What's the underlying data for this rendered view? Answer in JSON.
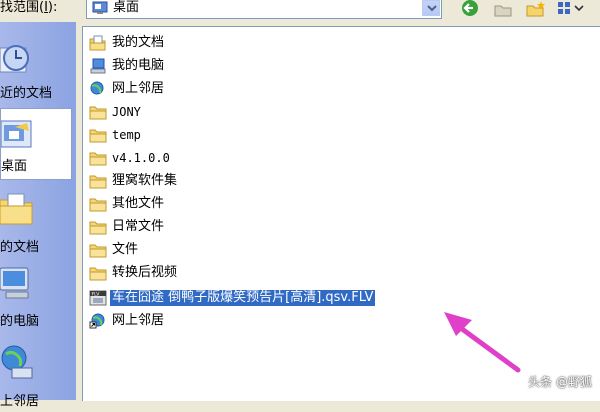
{
  "toolbar": {
    "lookin_label": "找范围(",
    "lookin_underline": "I",
    "lookin_suffix": "):",
    "current_folder": "桌面"
  },
  "places": [
    {
      "label": "近的文档",
      "icon": "recent-documents-icon",
      "selected": false
    },
    {
      "label": "桌面",
      "icon": "desktop-icon",
      "selected": true
    },
    {
      "label": "的文档",
      "icon": "my-documents-icon",
      "selected": false
    },
    {
      "label": "的电脑",
      "icon": "my-computer-icon",
      "selected": false
    },
    {
      "label": "上邻居",
      "icon": "network-places-icon",
      "selected": false
    }
  ],
  "files": [
    {
      "name": "我的文档",
      "icon": "my-documents-icon",
      "mono": false
    },
    {
      "name": "我的电脑",
      "icon": "my-computer-icon",
      "mono": false
    },
    {
      "name": "网上邻居",
      "icon": "network-places-icon",
      "mono": false
    },
    {
      "name": "JONY",
      "icon": "folder-icon",
      "mono": true
    },
    {
      "name": "temp",
      "icon": "folder-icon",
      "mono": true
    },
    {
      "name": "v4.1.0.0",
      "icon": "folder-icon",
      "mono": true
    },
    {
      "name": "狸窝软件集",
      "icon": "folder-icon",
      "mono": false
    },
    {
      "name": "其他文件",
      "icon": "folder-icon",
      "mono": false
    },
    {
      "name": "日常文件",
      "icon": "folder-icon",
      "mono": false
    },
    {
      "name": "文件",
      "icon": "folder-icon",
      "mono": false
    },
    {
      "name": "转换后视频",
      "icon": "folder-icon",
      "mono": false
    },
    {
      "name": "车在囧途 倒鸭子版爆笑预告片[高清].qsv.FLV",
      "icon": "flv-file-icon",
      "mono": false,
      "selected": true
    },
    {
      "name": "网上邻居",
      "icon": "network-shortcut-icon",
      "mono": false
    }
  ],
  "colors": {
    "selection": "#316ac5",
    "arrow": "#e040c8",
    "places_bar": "#8ba3e2"
  },
  "watermark": "头条 @野狐"
}
